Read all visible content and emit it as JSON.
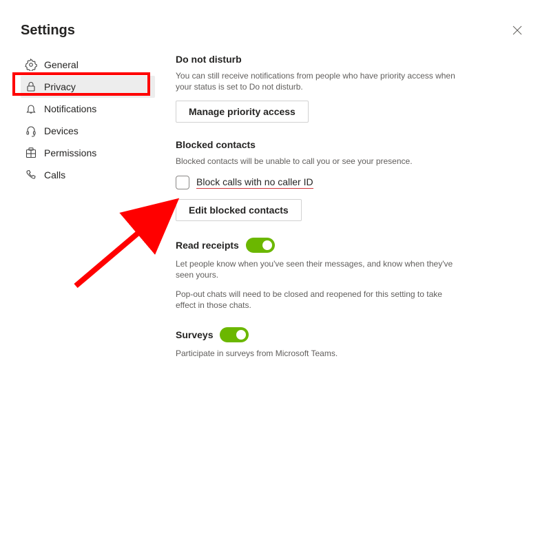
{
  "title": "Settings",
  "sidebar": {
    "items": [
      {
        "label": "General"
      },
      {
        "label": "Privacy"
      },
      {
        "label": "Notifications"
      },
      {
        "label": "Devices"
      },
      {
        "label": "Permissions"
      },
      {
        "label": "Calls"
      }
    ],
    "selected_index": 1
  },
  "sections": {
    "dnd": {
      "title": "Do not disturb",
      "desc": "You can still receive notifications from people who have priority access when your status is set to Do not disturb.",
      "button": "Manage priority access"
    },
    "blocked": {
      "title": "Blocked contacts",
      "desc": "Blocked contacts will be unable to call you or see your presence.",
      "checkbox_label": "Block calls with no caller ID",
      "checkbox_checked": false,
      "button": "Edit blocked contacts"
    },
    "read_receipts": {
      "title": "Read receipts",
      "toggle_on": true,
      "desc": "Let people know when you've seen their messages, and know when they've seen yours.",
      "desc2": "Pop-out chats will need to be closed and reopened for this setting to take effect in those chats."
    },
    "surveys": {
      "title": "Surveys",
      "toggle_on": true,
      "desc": "Participate in surveys from Microsoft Teams."
    }
  },
  "annotations": {
    "privacy_highlight_color": "#ff0000",
    "arrow_color": "#ff0000",
    "checkbox_underline_color": "#d13438"
  }
}
